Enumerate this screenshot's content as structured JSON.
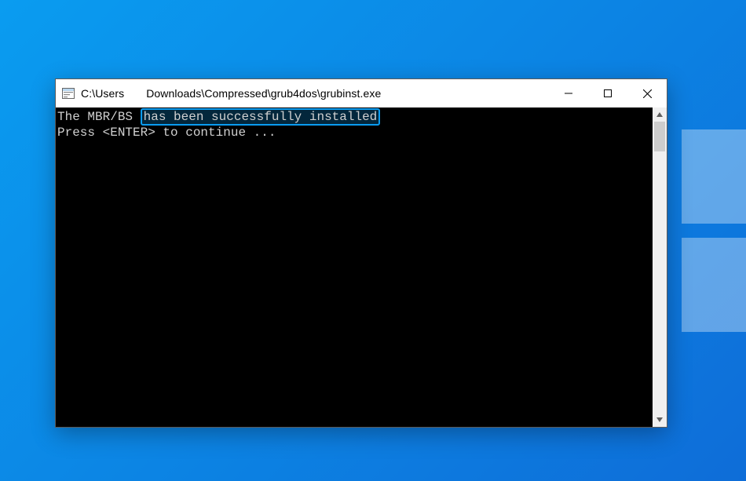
{
  "window": {
    "title_prefix": "C:\\Users",
    "title_path": "Downloads\\Compressed\\grub4dos\\grubinst.exe"
  },
  "terminal": {
    "line1_prefix": "The MBR/BS ",
    "line1_highlight": "has been successfully installed",
    "line2": "Press <ENTER> to continue ..."
  },
  "controls": {
    "minimize": "Minimize",
    "maximize": "Maximize",
    "close": "Close"
  }
}
